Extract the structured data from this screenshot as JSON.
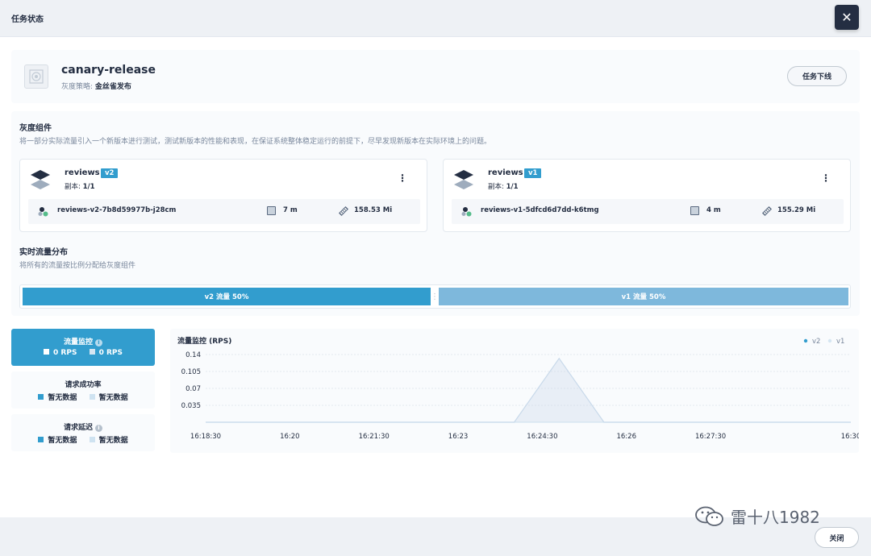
{
  "modal": {
    "title": "任务状态"
  },
  "header": {
    "name": "canary-release",
    "strategy_label": "灰度策略:",
    "strategy_value": "金丝雀发布",
    "offline_button": "任务下线"
  },
  "components": {
    "title": "灰度组件",
    "description": "将一部分实际流量引入一个新版本进行测试，测试新版本的性能和表现，在保证系统整体稳定运行的前提下，尽早发现新版本在实际环境上的问题。",
    "cards": [
      {
        "name": "reviews",
        "version": "v2",
        "replica_label": "副本:",
        "replica_value": "1/1",
        "pod": "reviews-v2-7b8d59977b-j28cm",
        "age": "7 m",
        "memory": "158.53 Mi"
      },
      {
        "name": "reviews",
        "version": "v1",
        "replica_label": "副本:",
        "replica_value": "1/1",
        "pod": "reviews-v1-5dfcd6d7dd-k6tmg",
        "age": "4 m",
        "memory": "155.29 Mi"
      }
    ]
  },
  "traffic": {
    "title": "实时流量分布",
    "description": "将所有的流量按比例分配给灰度组件",
    "v2_label": "v2 流量 50%",
    "v1_label": "v1 流量 50%",
    "v2_percent": 50,
    "v1_percent": 50
  },
  "metric_tabs": [
    {
      "title": "流量监控",
      "info": true,
      "val1": "0 RPS",
      "val2": "0 RPS",
      "active": true
    },
    {
      "title": "请求成功率",
      "info": false,
      "val1": "暂无数据",
      "val2": "暂无数据",
      "active": false
    },
    {
      "title": "请求延迟",
      "info": true,
      "val1": "暂无数据",
      "val2": "暂无数据",
      "active": false
    }
  ],
  "chart_data": {
    "type": "area",
    "title": "流量监控 (RPS)",
    "legend": [
      "v2",
      "v1"
    ],
    "legend_position": "top-right",
    "yticks": [
      "0.14",
      "0.105",
      "0.07",
      "0.035"
    ],
    "ylim": [
      0,
      0.14
    ],
    "xticks": [
      "16:18:30",
      "16:20",
      "16:21:30",
      "16:23",
      "16:24:30",
      "16:26",
      "16:27:30",
      "16:30"
    ],
    "series": [
      {
        "name": "v2",
        "color": "#329dce",
        "points": [
          [
            "16:18:30",
            0
          ],
          [
            "16:24:00",
            0
          ],
          [
            "16:24:48",
            0.132
          ],
          [
            "16:25:36",
            0
          ],
          [
            "16:30",
            0
          ]
        ]
      },
      {
        "name": "v1",
        "color": "#d5e6f2",
        "points": [
          [
            "16:18:30",
            0
          ],
          [
            "16:30",
            0
          ]
        ]
      }
    ]
  },
  "footer": {
    "close_button": "关闭"
  },
  "watermark": {
    "text": "雷十八1982"
  }
}
